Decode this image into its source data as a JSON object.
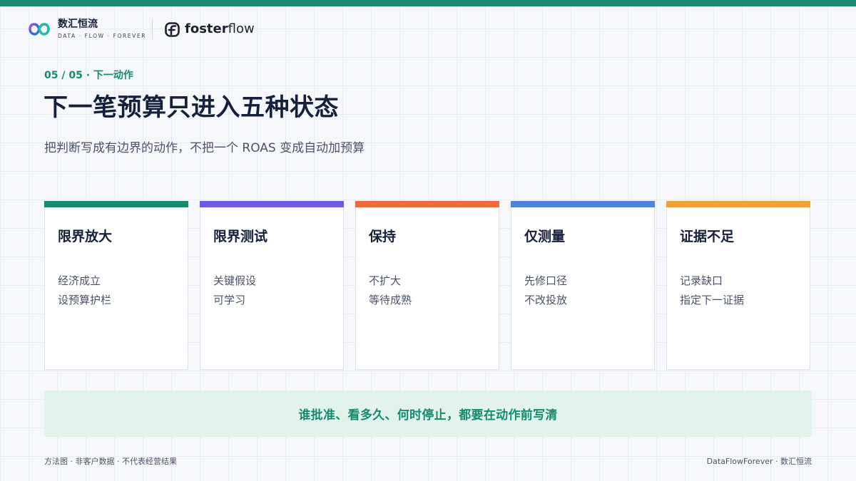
{
  "brand": {
    "name": "数汇恒流",
    "tagline": "DATA · FLOW · FOREVER",
    "logo_icon": "infinity-loop-icon",
    "accent_color": "#178a6e"
  },
  "partner": {
    "name_bold": "foster",
    "name_light": "flow",
    "icon": "fosterflow-f-icon"
  },
  "header": {
    "crumb": "05 / 05 · 下一动作",
    "title": "下一笔预算只进入五种状态",
    "subtitle": "把判断写成有边界的动作，不把一个 ROAS 变成自动加预算"
  },
  "cards": [
    {
      "title": "限界放大",
      "lines": [
        "经济成立",
        "设预算护栏"
      ],
      "color": "#178a6e"
    },
    {
      "title": "限界测试",
      "lines": [
        "关键假设",
        "可学习"
      ],
      "color": "#6b5ae6"
    },
    {
      "title": "保持",
      "lines": [
        "不扩大",
        "等待成熟"
      ],
      "color": "#ef6a3a"
    },
    {
      "title": "仅测量",
      "lines": [
        "先修口径",
        "不改投放"
      ],
      "color": "#5082dc"
    },
    {
      "title": "证据不足",
      "lines": [
        "记录缺口",
        "指定下一证据"
      ],
      "color": "#eea23a"
    }
  ],
  "banner": {
    "text": "谁批准、看多久、何时停止，都要在动作前写清"
  },
  "footer": {
    "left": "方法图 · 非客户数据 · 不代表经营结果",
    "right": "DataFlowForever · 数汇恒流"
  }
}
